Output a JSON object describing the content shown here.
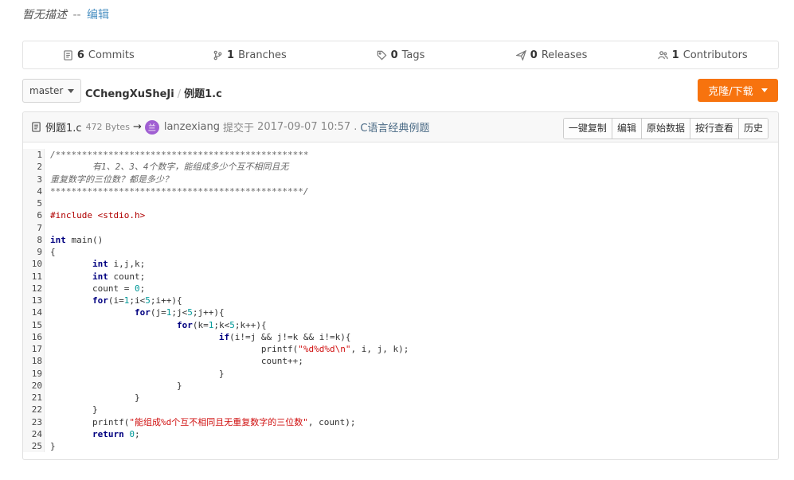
{
  "description": {
    "text": "暂无描述",
    "sep": "--",
    "edit": "编辑"
  },
  "stats": [
    {
      "icon": "commits-icon",
      "count": "6",
      "label": "Commits"
    },
    {
      "icon": "branch-icon",
      "count": "1",
      "label": "Branches"
    },
    {
      "icon": "tag-icon",
      "count": "0",
      "label": "Tags"
    },
    {
      "icon": "release-icon",
      "count": "0",
      "label": "Releases"
    },
    {
      "icon": "contributors-icon",
      "count": "1",
      "label": "Contributors"
    }
  ],
  "branch": {
    "name": "master"
  },
  "breadcrumb": {
    "repo": "CChengXuSheJi",
    "file": "例题1.c"
  },
  "clone_button": {
    "label": "克隆/下载",
    "color": "#f7730e"
  },
  "file": {
    "name": "例题1.c",
    "size": "472 Bytes",
    "arrow": "→",
    "avatar_letter": "兰",
    "author": "lanzexiang",
    "action": "提交于",
    "date": "2017-09-07 10:57",
    "dot": ".",
    "commit_message": "C语言经典例题",
    "buttons": [
      "一键复制",
      "编辑",
      "原始数据",
      "按行查看",
      "历史"
    ]
  },
  "code": {
    "line_numbers": [
      "1",
      "2",
      "3",
      "4",
      "5",
      "6",
      "7",
      "8",
      "9",
      "10",
      "11",
      "12",
      "13",
      "14",
      "15",
      "16",
      "17",
      "18",
      "19",
      "20",
      "21",
      "22",
      "23",
      "24",
      "25"
    ],
    "lines": [
      [
        {
          "t": "/************************************************",
          "c": "comment"
        }
      ],
      [
        {
          "t": "        有1、2、3、4个数字，能组成多少个互不相同且无",
          "c": "comment"
        }
      ],
      [
        {
          "t": "重复数字的三位数？都是多少？",
          "c": "comment"
        }
      ],
      [
        {
          "t": "************************************************/",
          "c": "comment"
        }
      ],
      [
        {
          "t": "",
          "c": ""
        }
      ],
      [
        {
          "t": "#include <stdio.h>",
          "c": "pre"
        }
      ],
      [
        {
          "t": "",
          "c": ""
        }
      ],
      [
        {
          "t": "int",
          "c": "kw"
        },
        {
          "t": " main()",
          "c": ""
        }
      ],
      [
        {
          "t": "{",
          "c": ""
        }
      ],
      [
        {
          "t": "        ",
          "c": ""
        },
        {
          "t": "int",
          "c": "kw"
        },
        {
          "t": " i,j,k;",
          "c": ""
        }
      ],
      [
        {
          "t": "        ",
          "c": ""
        },
        {
          "t": "int",
          "c": "kw"
        },
        {
          "t": " count;",
          "c": ""
        }
      ],
      [
        {
          "t": "        count = ",
          "c": ""
        },
        {
          "t": "0",
          "c": "num"
        },
        {
          "t": ";",
          "c": ""
        }
      ],
      [
        {
          "t": "        ",
          "c": ""
        },
        {
          "t": "for",
          "c": "kw"
        },
        {
          "t": "(i=",
          "c": ""
        },
        {
          "t": "1",
          "c": "num"
        },
        {
          "t": ";i<",
          "c": ""
        },
        {
          "t": "5",
          "c": "num"
        },
        {
          "t": ";i++){",
          "c": ""
        }
      ],
      [
        {
          "t": "                ",
          "c": ""
        },
        {
          "t": "for",
          "c": "kw"
        },
        {
          "t": "(j=",
          "c": ""
        },
        {
          "t": "1",
          "c": "num"
        },
        {
          "t": ";j<",
          "c": ""
        },
        {
          "t": "5",
          "c": "num"
        },
        {
          "t": ";j++){",
          "c": ""
        }
      ],
      [
        {
          "t": "                        ",
          "c": ""
        },
        {
          "t": "for",
          "c": "kw"
        },
        {
          "t": "(k=",
          "c": ""
        },
        {
          "t": "1",
          "c": "num"
        },
        {
          "t": ";k<",
          "c": ""
        },
        {
          "t": "5",
          "c": "num"
        },
        {
          "t": ";k++){",
          "c": ""
        }
      ],
      [
        {
          "t": "                                ",
          "c": ""
        },
        {
          "t": "if",
          "c": "kw"
        },
        {
          "t": "(i!=j && j!=k && i!=k){",
          "c": ""
        }
      ],
      [
        {
          "t": "                                        printf(",
          "c": ""
        },
        {
          "t": "\"%d%d%d\\n\"",
          "c": "str"
        },
        {
          "t": ", i, j, k);",
          "c": ""
        }
      ],
      [
        {
          "t": "                                        count++;",
          "c": ""
        }
      ],
      [
        {
          "t": "                                }",
          "c": ""
        }
      ],
      [
        {
          "t": "                        }",
          "c": ""
        }
      ],
      [
        {
          "t": "                }",
          "c": ""
        }
      ],
      [
        {
          "t": "        }",
          "c": ""
        }
      ],
      [
        {
          "t": "        printf(",
          "c": ""
        },
        {
          "t": "\"能组成%d个互不相同且无重复数字的三位数\"",
          "c": "str"
        },
        {
          "t": ", count);",
          "c": ""
        }
      ],
      [
        {
          "t": "        ",
          "c": ""
        },
        {
          "t": "return",
          "c": "kw"
        },
        {
          "t": " ",
          "c": ""
        },
        {
          "t": "0",
          "c": "num"
        },
        {
          "t": ";",
          "c": ""
        }
      ],
      [
        {
          "t": "}",
          "c": ""
        }
      ]
    ]
  }
}
